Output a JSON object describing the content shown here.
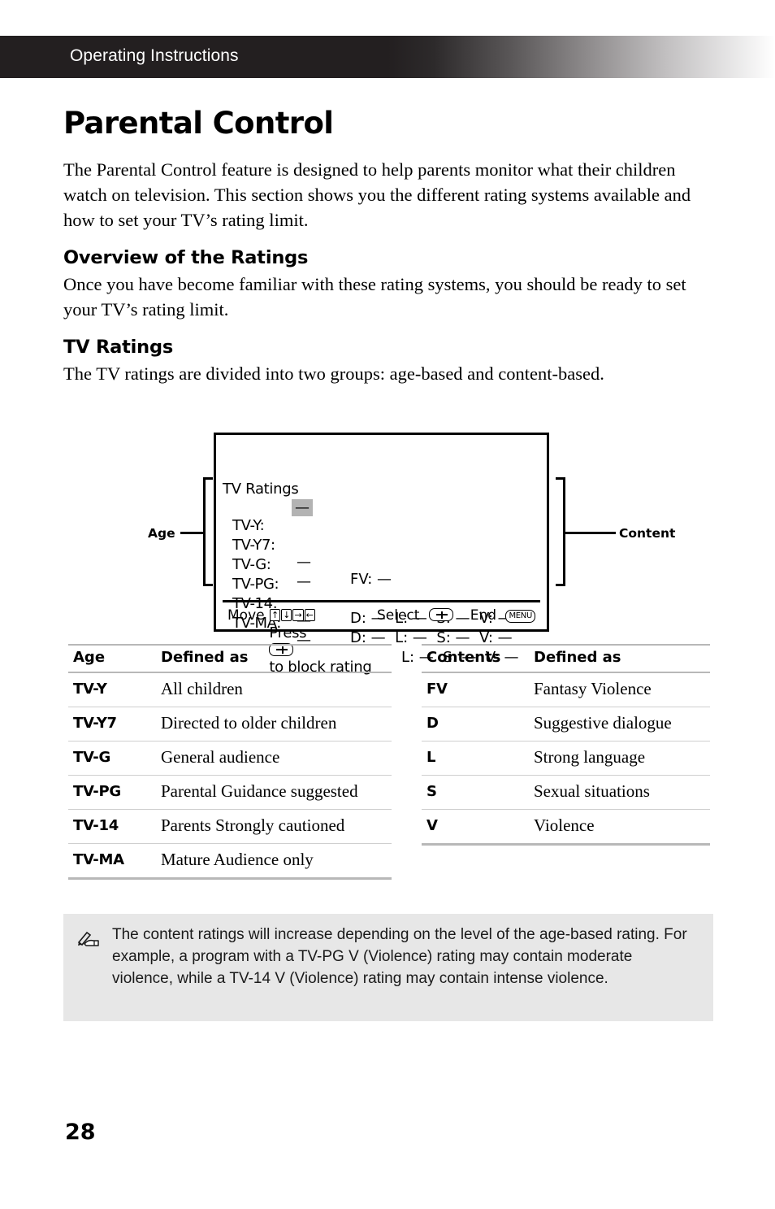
{
  "header": {
    "running_title": "Operating Instructions"
  },
  "page": {
    "title": "Parental Control",
    "intro": "The Parental Control feature is designed to help parents monitor what their children watch on television. This section shows you the different rating systems available and how to set your TV’s rating limit.",
    "number": "28"
  },
  "sections": [
    {
      "heading": "Overview of the Ratings",
      "body": "Once you have become familiar with these rating systems, you should be ready to set your TV’s rating limit."
    },
    {
      "heading": "TV Ratings",
      "body": "The TV ratings are divided into two groups: age-based and content-based."
    }
  ],
  "osd": {
    "title": "TV Ratings",
    "rows": [
      {
        "age_label": "TV-Y:",
        "age_value": "—",
        "age_highlighted": true,
        "content": ""
      },
      {
        "age_label": "TV-Y7:",
        "age_value": "—",
        "age_highlighted": false,
        "content": "FV: —"
      },
      {
        "age_label": "TV-G:",
        "age_value": "—",
        "age_highlighted": false,
        "content": ""
      },
      {
        "age_label": "TV-PG:",
        "age_value": "—",
        "age_highlighted": false,
        "content": "D: —  L: —  S: —  V: —"
      },
      {
        "age_label": "TV-14:",
        "age_value": "—",
        "age_highlighted": false,
        "content": "D: —  L: —  S: —  V: —"
      },
      {
        "age_label": "TV-MA:",
        "age_value": "—",
        "age_highlighted": false,
        "content": "           L: —  S: —  V: —"
      }
    ],
    "press_prefix": "Press",
    "press_suffix": "to block rating",
    "action_bar": {
      "move_label": "Move",
      "move_keys": [
        "↑",
        "↓",
        "→",
        "←"
      ],
      "select_label": "Select",
      "end_label": "End",
      "menu_button_label": "MENU"
    },
    "callouts": {
      "left": "Age",
      "right": "Content"
    }
  },
  "table_age": {
    "headers": [
      "Age",
      "Defined as"
    ],
    "rows": [
      [
        "TV-Y",
        "All children"
      ],
      [
        "TV-Y7",
        "Directed to older children"
      ],
      [
        "TV-G",
        "General audience"
      ],
      [
        "TV-PG",
        "Parental Guidance suggested"
      ],
      [
        "TV-14",
        "Parents Strongly cautioned"
      ],
      [
        "TV-MA",
        "Mature Audience only"
      ]
    ]
  },
  "table_contents": {
    "headers": [
      "Contents",
      "Defined as"
    ],
    "rows": [
      [
        "FV",
        "Fantasy Violence"
      ],
      [
        "D",
        "Suggestive dialogue"
      ],
      [
        "L",
        "Strong language"
      ],
      [
        "S",
        "Sexual situations"
      ],
      [
        "V",
        "Violence"
      ]
    ]
  },
  "note": {
    "icon": "writing-hand-icon",
    "text": "The content ratings will increase depending on the level of the age-based rating. For example, a program with a TV-PG V (Violence) rating may contain moderate violence, while a TV-14 V (Violence) rating may contain intense violence."
  },
  "colors": {
    "header_band": "#231f20",
    "note_background": "#e7e7e7",
    "osd_highlight": "#b3b3b3",
    "rule": "#b8b8b8"
  }
}
